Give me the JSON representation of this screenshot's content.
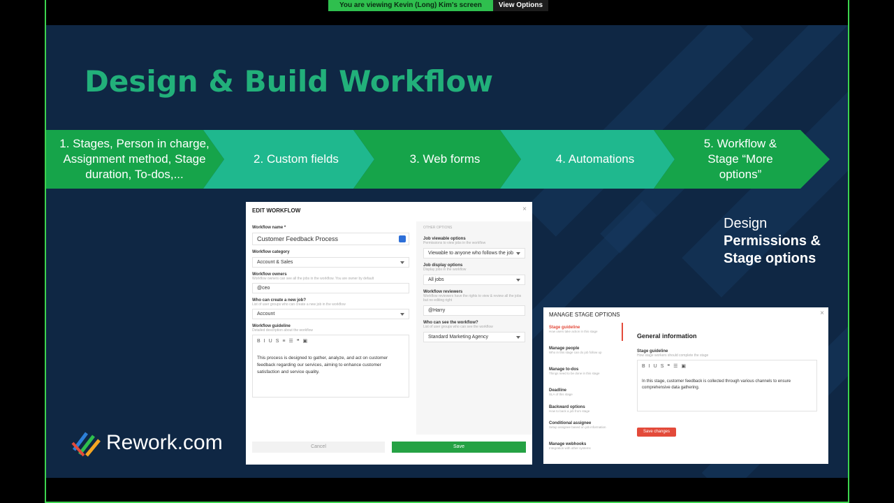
{
  "banner": {
    "viewing": "You are viewing  Kevin (Long) Kim's screen",
    "options": "View Options"
  },
  "slide": {
    "title": "Design & Build Workflow",
    "steps": [
      "1. Stages, Person in charge, Assignment method, Stage duration, To-dos,...",
      "2. Custom fields",
      "3. Web forms",
      "4. Automations",
      "5. Workflow & Stage “More options”"
    ],
    "right_text": {
      "line1": "Design",
      "line2": "Permissions &",
      "line3": "Stage options"
    },
    "logo": "Rework.com"
  },
  "edit_workflow": {
    "title": "EDIT WORKFLOW",
    "name_label": "Workflow name *",
    "name_value": "Customer Feedback Process",
    "category_label": "Workflow category",
    "category_value": "Account & Sales",
    "owners_label": "Workflow owners",
    "owners_hint": "Workflow owners can see all the jobs in the workflow. You are owner by default",
    "owners_value": "@ceo",
    "create_label": "Who can create a new job?",
    "create_hint": "List of user groups who can create a new job in the workflow",
    "create_value": "Account",
    "guideline_label": "Workflow guideline",
    "guideline_hint": "Detailed description about the workflow",
    "guideline_text": "This process is designed to gather, analyze, and act on customer feedback regarding our services, aiming to enhance customer satisfaction and service quality.",
    "other_options": "OTHER OPTIONS",
    "viewable_label": "Job viewable options",
    "viewable_hint": "Permissions to view jobs in the workflow",
    "viewable_value": "Viewable to anyone who follows the job",
    "display_label": "Job display options",
    "display_hint": "Display jobs in the workflow",
    "display_value": "All jobs",
    "reviewers_label": "Workflow reviewers",
    "reviewers_hint": "Workflow reviewers have the rights to view & review all the jobs but no editing right",
    "reviewers_value": "@Harry",
    "see_label": "Who can see the workflow?",
    "see_hint": "List of user groups who can see the workflow",
    "see_value": "Standard Marketing Agency",
    "cancel": "Cancel",
    "save": "Save"
  },
  "manage_stage": {
    "title": "MANAGE STAGE OPTIONS",
    "items": [
      {
        "t": "Stage guideline",
        "d": "How users take action in this stage"
      },
      {
        "t": "Manage people",
        "d": "Who in this stage can do job follow up"
      },
      {
        "t": "Manage to-dos",
        "d": "Things need to be done in this stage"
      },
      {
        "t": "Deadline",
        "d": "SLA of this stage"
      },
      {
        "t": "Backward options",
        "d": "How to back a job from stage"
      },
      {
        "t": "Conditional assignee",
        "d": "Setup assignee based on job information"
      },
      {
        "t": "Manage webhooks",
        "d": "Integration with other systems"
      }
    ],
    "section": "General information",
    "guideline_label": "Stage guideline",
    "guideline_hint": "How stage workers should complete the stage",
    "guideline_text": "In this stage, customer feedback is collected through various channels to ensure comprehensive data gathering.",
    "save": "Save changes"
  },
  "colors": {
    "accent": "#22b07a",
    "green": "#25a244",
    "red": "#e34a3a",
    "bg": "#0f2744"
  }
}
